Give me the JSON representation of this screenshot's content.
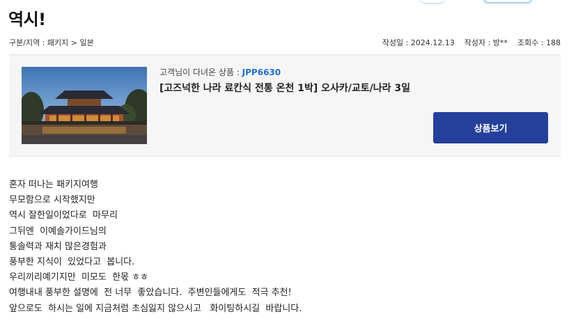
{
  "post": {
    "title": "역시!",
    "category": "구분/지역 : 패키지 > 일본",
    "meta": {
      "date": "작성일 : 2024.12.13",
      "author": "작성자 : 방**",
      "views": "조회수 : 188"
    }
  },
  "product": {
    "code_label": "고객님이 다녀온 상품 : ",
    "code": "JPP6630",
    "name": "[고즈넉한 나라 료칸식 전통 온천 1박] 오사카/교토/나라 3일",
    "button_label": "상품보기"
  },
  "body_lines": [
    "혼자 떠나는 패키지여행",
    "무모함으로 시작했지만",
    "역시 잘한일이었다로  마무리",
    "그뒤엔  이예솔가이드님의",
    "통솔력과 재치 많은경험과",
    "풍부한 지식이  있었다고  봅니다.",
    "우리끼리예기지만  미모도  한몫 ㅎㅎ",
    "여행내내 풍부한 설명에  전 너무  좋았습니다.  주변인들에게도  적극 추천!",
    "앞으로도  하시는 일에 지금처럼 초심잃지 않으시고   화이팅하시길  바랍니다."
  ]
}
